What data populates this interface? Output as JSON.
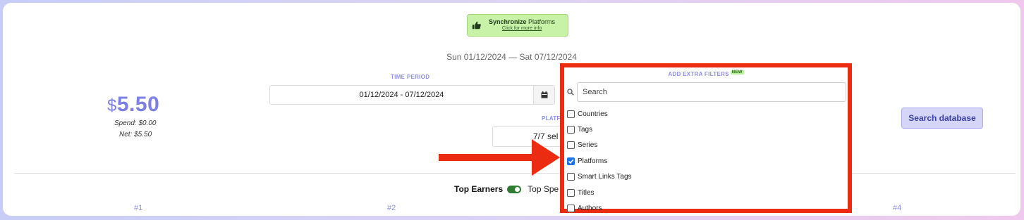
{
  "sync": {
    "title_bold": "Synchronize",
    "title_rest": " Platforms",
    "link": "Click for more info"
  },
  "date_range": "Sun 01/12/2024 — Sat 07/12/2024",
  "summary": {
    "currency": "$",
    "amount": "5.50",
    "spend": "Spend: $0.00",
    "net": "Net: $5.50"
  },
  "time_period": {
    "label": "TIME PERIOD",
    "value": "01/12/2024 - 07/12/2024"
  },
  "platforms": {
    "label": "PLATF",
    "value": "7/7 sel"
  },
  "filters": {
    "header": "ADD EXTRA FILTERS",
    "badge": "NEW",
    "search_placeholder": "Search",
    "items": [
      {
        "label": "Countries",
        "checked": false
      },
      {
        "label": "Tags",
        "checked": false
      },
      {
        "label": "Series",
        "checked": false
      },
      {
        "label": "Platforms",
        "checked": true
      },
      {
        "label": "Smart Links Tags",
        "checked": false
      },
      {
        "label": "Titles",
        "checked": false
      },
      {
        "label": "Authors",
        "checked": false
      }
    ]
  },
  "search_db_label": "Search database",
  "earners": {
    "top_earners": "Top Earners",
    "top_spenders": "Top Spe"
  },
  "ranks": [
    "#1",
    "#2",
    "#4"
  ],
  "colors": {
    "accent": "#8c8fe6",
    "highlight": "#ec2c12",
    "sync_bg": "#c9f2a9"
  }
}
